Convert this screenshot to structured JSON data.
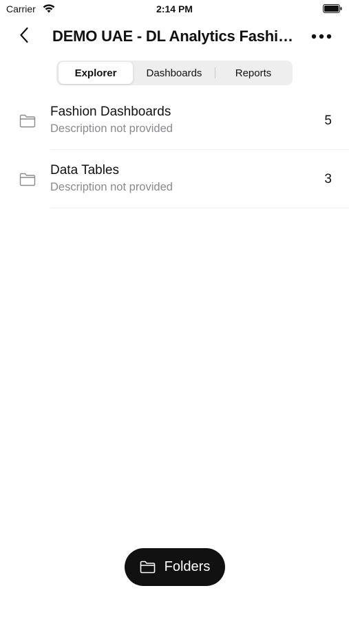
{
  "status_bar": {
    "carrier": "Carrier",
    "time": "2:14 PM"
  },
  "nav": {
    "title": "DEMO UAE - DL Analytics  Fashion Dashboards",
    "back_icon": "chevron-left-icon",
    "more_icon": "ellipsis-icon"
  },
  "tabs": [
    {
      "label": "Explorer",
      "active": true
    },
    {
      "label": "Dashboards",
      "active": false
    },
    {
      "label": "Reports",
      "active": false
    }
  ],
  "folders": [
    {
      "title": "Fashion Dashboards",
      "description": "Description not provided",
      "count": "5",
      "icon": "folder-icon"
    },
    {
      "title": "Data Tables",
      "description": "Description not provided",
      "count": "3",
      "icon": "folder-icon"
    }
  ],
  "bottom_button": {
    "label": "Folders",
    "icon": "folder-icon"
  },
  "colors": {
    "text_primary": "#111111",
    "text_secondary": "#8a8a8e",
    "segment_bg": "#eeeeef",
    "button_bg": "#111111"
  }
}
